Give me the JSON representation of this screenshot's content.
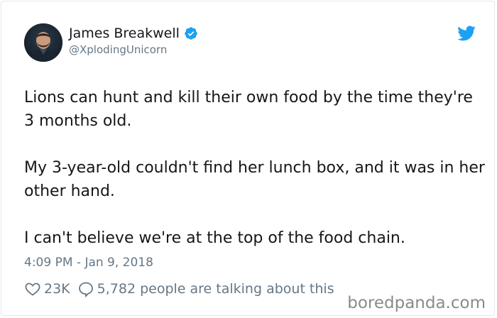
{
  "tweet": {
    "author": {
      "display_name": "James Breakwell",
      "handle": "@XplodingUnicorn",
      "verified": true
    },
    "paragraphs": [
      "Lions can hunt and kill their own food by the time they're 3 months old.",
      "My 3-year-old couldn't find her lunch box, and it was in her other hand.",
      "I can't believe we're at the top of the food chain."
    ],
    "timestamp": "4:09 PM - Jan 9, 2018",
    "likes": "23K",
    "conversation": "5,782 people are talking about this"
  },
  "watermark": "boredpanda.com",
  "colors": {
    "twitter_blue": "#1da1f2",
    "text": "#14171a",
    "secondary": "#657786"
  },
  "icons": {
    "brand": "twitter-bird-icon",
    "verified": "verified-badge-icon",
    "like": "heart-icon",
    "reply": "speech-bubble-icon"
  }
}
